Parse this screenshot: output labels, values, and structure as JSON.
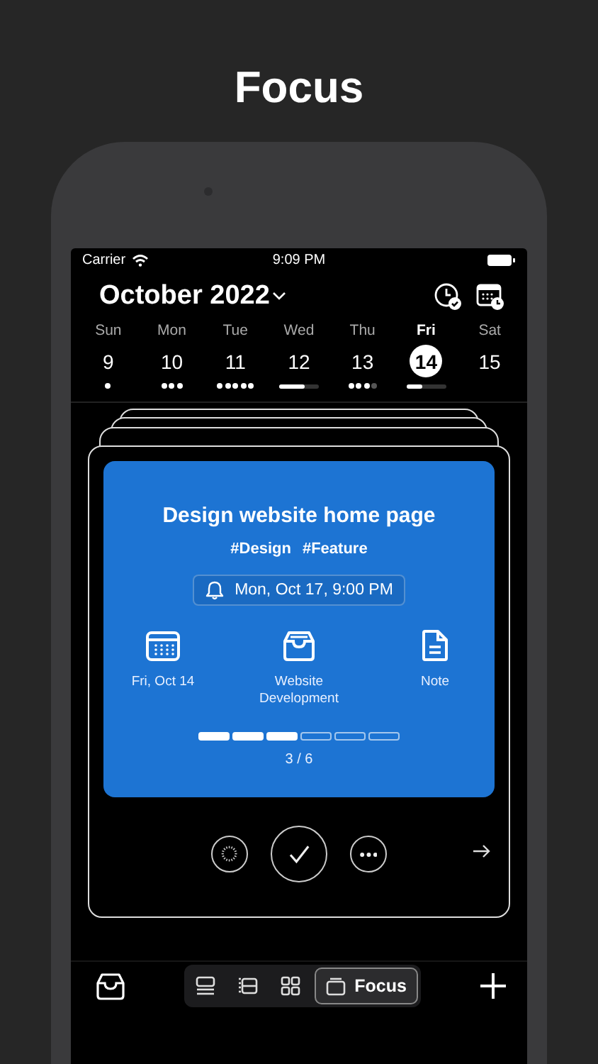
{
  "page_title": "Focus",
  "status_bar": {
    "carrier": "Carrier",
    "time": "9:09 PM"
  },
  "header": {
    "month": "October 2022"
  },
  "days": [
    {
      "weekday": "Sun",
      "date": "9",
      "selected": false,
      "indicator": {
        "kind": "dots",
        "dots": [
          true
        ]
      }
    },
    {
      "weekday": "Mon",
      "date": "10",
      "selected": false,
      "indicator": {
        "kind": "dots",
        "dots": [
          true,
          true,
          true
        ]
      }
    },
    {
      "weekday": "Tue",
      "date": "11",
      "selected": false,
      "indicator": {
        "kind": "dots",
        "dots": [
          true,
          true,
          true,
          true,
          true
        ]
      }
    },
    {
      "weekday": "Wed",
      "date": "12",
      "selected": false,
      "indicator": {
        "kind": "bar",
        "level": 0.65
      }
    },
    {
      "weekday": "Thu",
      "date": "13",
      "selected": false,
      "indicator": {
        "kind": "dots",
        "dots": [
          true,
          true,
          true,
          false
        ]
      }
    },
    {
      "weekday": "Fri",
      "date": "14",
      "selected": true,
      "indicator": {
        "kind": "bar",
        "level": 0.4
      }
    },
    {
      "weekday": "Sat",
      "date": "15",
      "selected": false
    }
  ],
  "task": {
    "title": "Design website home page",
    "tags": [
      "#Design",
      "#Feature"
    ],
    "reminder": "Mon, Oct 17, 9:00 PM",
    "details": [
      {
        "kind": "date",
        "label": "Fri, Oct 14"
      },
      {
        "kind": "project",
        "label": "Website Development"
      },
      {
        "kind": "note",
        "label": "Note"
      }
    ],
    "steps": [
      {
        "done": true
      },
      {
        "done": true
      },
      {
        "done": true
      },
      {
        "done": false
      },
      {
        "done": false
      },
      {
        "done": false
      }
    ],
    "progress": "3 / 6"
  },
  "tab_bar": {
    "views": [
      {
        "kind": "list",
        "selected": false
      },
      {
        "kind": "timeline",
        "selected": false
      },
      {
        "kind": "grid",
        "selected": false
      },
      {
        "kind": "focus",
        "label": "Focus",
        "selected": true
      }
    ]
  }
}
